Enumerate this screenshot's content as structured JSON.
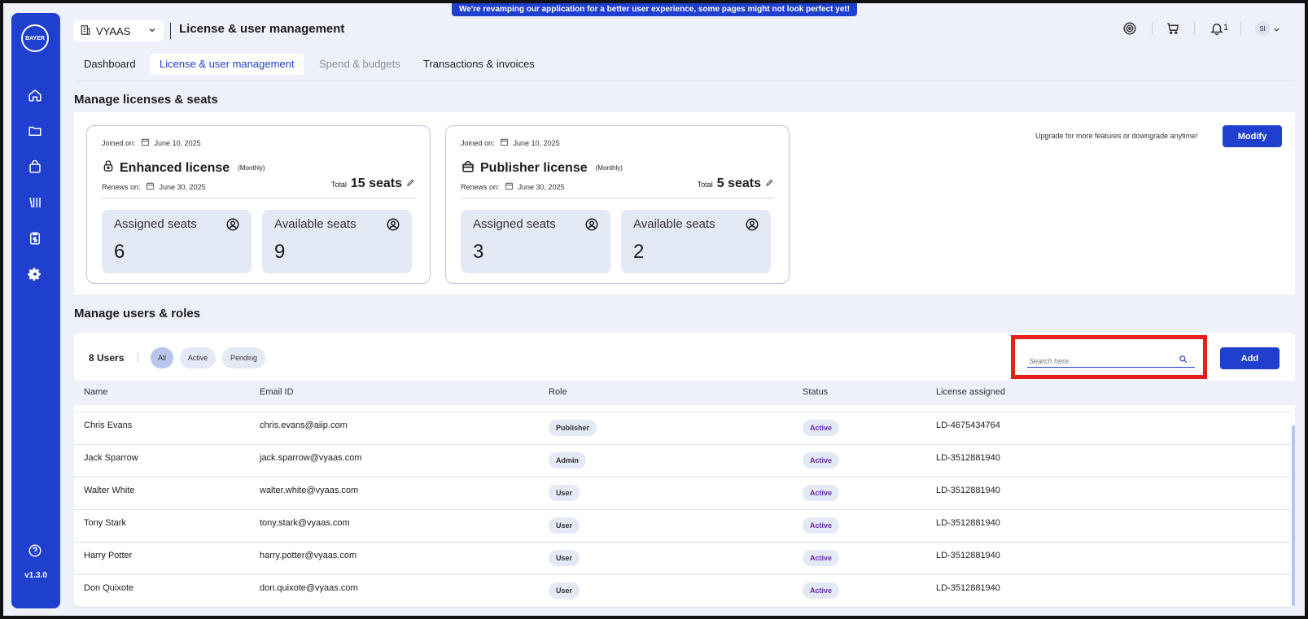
{
  "banner": {
    "text": "We're revamping our application for a better user experience, some pages might not look perfect yet!"
  },
  "sidebar": {
    "logo_text": "BAYER",
    "items": [
      {
        "icon": "home-icon"
      },
      {
        "icon": "folder-icon"
      },
      {
        "icon": "bag-icon"
      },
      {
        "icon": "library-icon"
      },
      {
        "icon": "clipboard-dollar-icon"
      },
      {
        "icon": "gear-icon"
      }
    ],
    "help_icon": "help-icon",
    "version": "v1.3.0"
  },
  "header": {
    "org_name": "VYAAS",
    "page_title": "License & user management",
    "notification_count": "1",
    "avatar_initials": "SI"
  },
  "tabs": [
    {
      "label": "Dashboard"
    },
    {
      "label": "License & user management"
    },
    {
      "label": "Spend & budgets"
    },
    {
      "label": "Transactions & invoices"
    }
  ],
  "licenses_section": {
    "title": "Manage licenses & seats",
    "upgrade_text": "Upgrade for more features or downgrade anytime!",
    "modify_label": "Modify",
    "cards": [
      {
        "joined_label": "Joined on:",
        "joined_date": "June 10, 2025",
        "name": "Enhanced license",
        "period": "(Monthly)",
        "renews_label": "Renews on:",
        "renews_date": "June 30, 2025",
        "total_label": "Total",
        "total_seats": "15 seats",
        "assigned_label": "Assigned seats",
        "assigned_value": "6",
        "available_label": "Available seats",
        "available_value": "9"
      },
      {
        "joined_label": "Joined on:",
        "joined_date": "June 10, 2025",
        "name": "Publisher license",
        "period": "(Monthly)",
        "renews_label": "Renews on:",
        "renews_date": "June 30, 2025",
        "total_label": "Total",
        "total_seats": "5 seats",
        "assigned_label": "Assigned seats",
        "assigned_value": "3",
        "available_label": "Available seats",
        "available_value": "2"
      }
    ]
  },
  "users_section": {
    "title": "Manage users & roles",
    "count": "8 Users",
    "filters": [
      {
        "label": "All"
      },
      {
        "label": "Active"
      },
      {
        "label": "Pending"
      }
    ],
    "search_placeholder": "Search here",
    "add_label": "Add",
    "columns": [
      "Name",
      "Email ID",
      "Role",
      "Status",
      "License assigned"
    ],
    "rows": [
      {
        "name": "Chris Evans",
        "email": "chris.evans@aiip.com",
        "role": "Publisher",
        "status": "Active",
        "license": "LD-4675434764"
      },
      {
        "name": "Jack Sparrow",
        "email": "jack.sparrow@vyaas.com",
        "role": "Admin",
        "status": "Active",
        "license": "LD-3512881940"
      },
      {
        "name": "Walter White",
        "email": "walter.white@vyaas.com",
        "role": "User",
        "status": "Active",
        "license": "LD-3512881940"
      },
      {
        "name": "Tony Stark",
        "email": "tony.stark@vyaas.com",
        "role": "User",
        "status": "Active",
        "license": "LD-3512881940"
      },
      {
        "name": "Harry Potter",
        "email": "harry.potter@vyaas.com",
        "role": "User",
        "status": "Active",
        "license": "LD-3512881940"
      },
      {
        "name": "Don Quixote",
        "email": "don.quixote@vyaas.com",
        "role": "User",
        "status": "Active",
        "license": "LD-3512881940"
      }
    ]
  },
  "colors": {
    "brand": "#1f3fcf",
    "highlight": "#e81e1e",
    "status_text": "#6b2bb0"
  }
}
